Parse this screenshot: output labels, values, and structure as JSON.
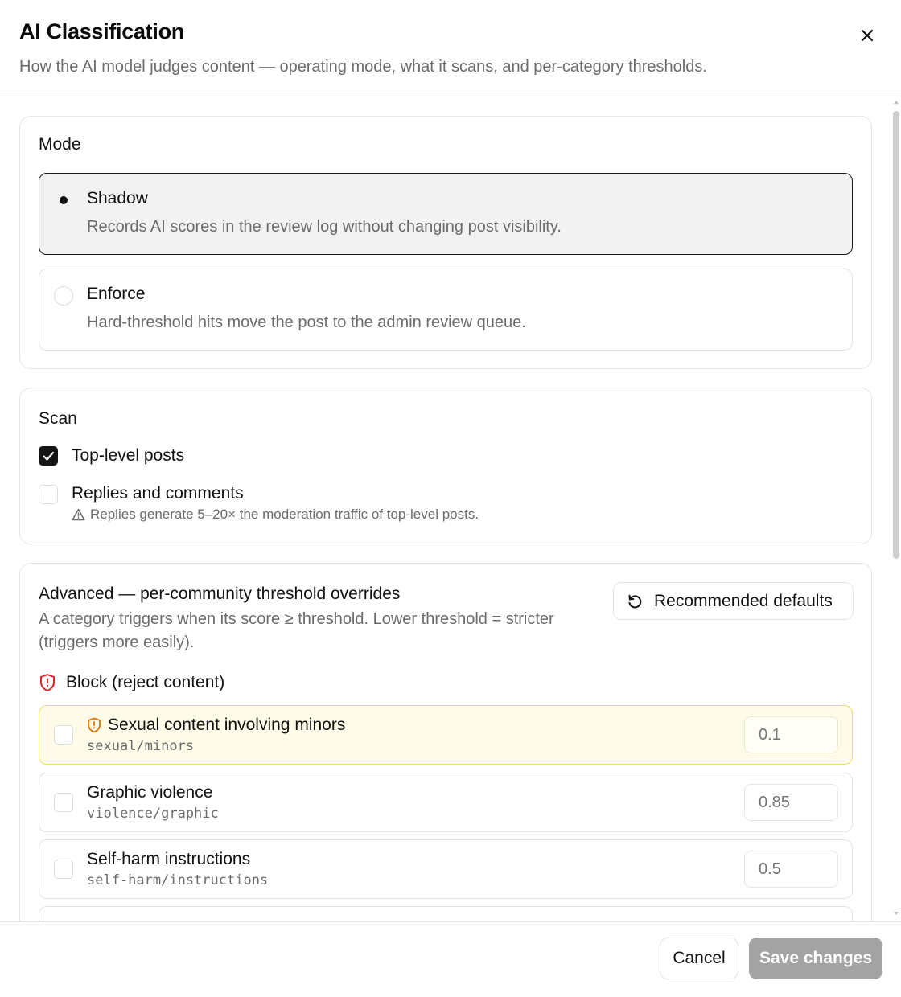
{
  "dialog": {
    "title": "AI Classification",
    "subtitle": "How the AI model judges content — operating mode, what it scans, and per-category thresholds."
  },
  "mode": {
    "title": "Mode",
    "options": [
      {
        "label": "Shadow",
        "description": "Records AI scores in the review log without changing post visibility.",
        "selected": true
      },
      {
        "label": "Enforce",
        "description": "Hard-threshold hits move the post to the admin review queue.",
        "selected": false
      }
    ]
  },
  "scan": {
    "title": "Scan",
    "items": [
      {
        "label": "Top-level posts",
        "checked": true
      },
      {
        "label": "Replies and comments",
        "checked": false,
        "hint": "Replies generate 5–20× the moderation traffic of top-level posts."
      }
    ]
  },
  "advanced": {
    "title": "Advanced — per-community threshold overrides",
    "description": "A category triggers when its score ≥ threshold. Lower threshold = stricter (triggers more easily).",
    "defaults_button": "Recommended defaults",
    "block_group": {
      "label": "Block (reject content)",
      "categories": [
        {
          "name": "Sexual content involving minors",
          "key": "sexual/minors",
          "threshold": "0.1",
          "highlighted": true,
          "checked": false
        },
        {
          "name": "Graphic violence",
          "key": "violence/graphic",
          "threshold": "0.85",
          "highlighted": false,
          "checked": false
        },
        {
          "name": "Self-harm instructions",
          "key": "self-harm/instructions",
          "threshold": "0.5",
          "highlighted": false,
          "checked": false
        }
      ]
    }
  },
  "footer": {
    "cancel_label": "Cancel",
    "save_label": "Save changes"
  },
  "colors": {
    "warn_bg": "#fefce8",
    "warn_border": "#ecdc6a",
    "block_icon": "#dc2626",
    "shield_warn_icon": "#d97706",
    "save_disabled": "#a3a3a3"
  },
  "icons": {
    "close": "close-icon",
    "reset": "rotate-ccw-icon",
    "block": "shield-alert-icon",
    "warning": "alert-triangle-icon",
    "check": "check-icon"
  }
}
